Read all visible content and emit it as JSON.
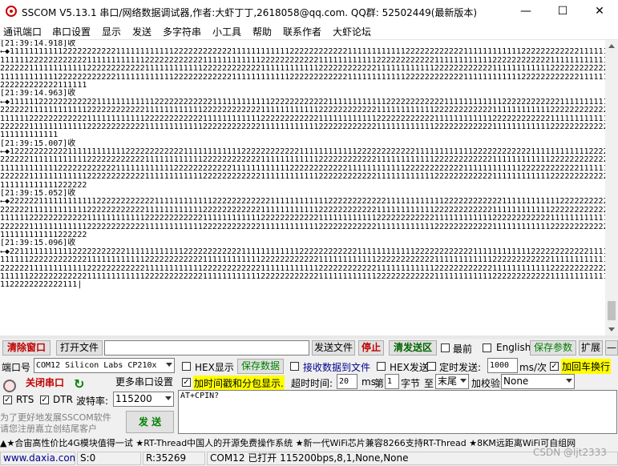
{
  "window": {
    "title": "SSCOM V5.13.1 串口/网络数据调试器,作者:大虾丁丁,2618058@qq.com. QQ群: 52502449(最新版本)",
    "minimize": "—",
    "maximize": "☐",
    "close": "✕"
  },
  "menu": [
    "通讯端口",
    "串口设置",
    "显示",
    "发送",
    "多字符串",
    "小工具",
    "帮助",
    "联系作者",
    "大虾论坛"
  ],
  "receive_lines": [
    "[21:39:14.918]收",
    "←◆1111111111122222222222111111111111222222222222111111111111222222222222111111111111222222222222111111111111222222222222111111",
    "111111222222222222111111111111222222222222111111111111222222222222111111111111222222222222111111111111222222222222111111111111",
    "222222111111111111222222222222111111111111222222222222111111111111222222222222111111111111222222222222111111111111222222222222",
    "111111111111222222222222111111111111222222222222111111111111222222222222111111111111222222222222111111111111222222222222111111",
    "222222222222111111",
    "[21:39:14.963]收",
    "←◆1111112222222222221111111111112222222222221111111111112222222222221111111111112222222222221111111111112222222222221111111111",
    "222222111111111111222222222222111111111111222222222222111111111111222222222222111111111111222222222222111111111111222222222222",
    "111111222222222222111111111111222222222222111111111111222222222222111111111111222222222222111111111111222222222222111111111111",
    "222222111111111111222222222222111111111111222222222222111111111111222222222222111111111111222222222222111111111111222222222222",
    "111111111111",
    "[21:39:15.007]收",
    "←◆1222222222221111111111112222222222221111111111112222222222221111111111112222222222221111111111112222222222221111111111112222",
    "222222111111111111222222222222111111111111222222222222111111111111222222222222111111111111222222222222111111111111222222222222",
    "111111111111222222222222111111111111222222222222111111111111222222222222111111111111222222222222111111111111222222222222111111",
    "222222111111111111222222222222111111111111222222222222111111111111222222222222111111111111222222222222111111111111222222222222",
    "111111111111222222",
    "[21:39:15.052]收",
    "←◆2222221111111111112222222222221111111111112222222222221111111111112222222222221111111111112222222222221111111111112222222222",
    "222222111111111111222222222222111111111111222222222222111111111111222222222222111111111111222222222222111111111111222222222222",
    "111111222222222222111111111111222222222222111111111111222222222222111111111111222222222222111111111111222222222222111111111111",
    "222222111111111111222222222222111111111111222222222222111111111111222222222222111111111111222222222222111111111111222222222222",
    "111111111111222222",
    "[21:39:15.096]收",
    "←◆2211111111111222222222221111111111112222222222221111111111112222222222221111111111112222222222221111111111112222222222221111",
    "111111222222222222111111111111222222222222111111111111222222222222111111111111222222222222111111111111222222222222111111111111",
    "222222111111111111222222222222111111111111222222222222111111111111222222222222111111111111222222222222111111111111222222222222",
    "111111222222222222111111111111222222222222111111111111222222222222111111111111222222222222111111111111222222222222111111111111",
    "1122222222222111|"
  ],
  "toolbar1": {
    "clear_window": "清除窗口",
    "open_file": "打开文件",
    "send_file": "发送文件",
    "stop": "停止",
    "clear_send": "清发送区",
    "top_most": "最前",
    "english": "English",
    "save_params": "保存参数",
    "expand": "扩展",
    "minus": "—"
  },
  "port_row": {
    "port_label": "端口号",
    "port_value": "COM12 Silicon Labs CP210x",
    "hex_display": "HEX显示",
    "save_data": "保存数据",
    "recv_to_file": "接收数据到文件",
    "hex_send": "HEX发送",
    "timed_send": "定时发送:",
    "interval": "1000",
    "interval_unit": "ms/次",
    "add_crlf": "加回车换行"
  },
  "row3": {
    "close_port": "关闭串口",
    "more_settings": "更多串口设置",
    "timestamp_split": "加时间戳和分包显示.",
    "timeout_label": "超时时间:",
    "timeout_value": "20",
    "ms": "ms",
    "nth_label": "第",
    "nth_value": "1",
    "byte_label": "字节",
    "to_label": "至",
    "end_value": "末尾",
    "checksum_label": "加校验",
    "checksum_value": "None"
  },
  "row4": {
    "rts": "RTS",
    "dtr": "DTR",
    "baud_label": "波特率:",
    "baud_value": "115200",
    "send_text": "AT+CPIN?"
  },
  "promo": {
    "line1": "为了更好地发展SSCOM软件",
    "line2": "请您注册嘉立创结尾客户",
    "send_button": "发  送"
  },
  "ticker": "▲★合宙高性价比4G模块值得一试 ★RT-Thread中国人的开源免费操作系统 ★新一代WiFi芯片兼容8266支持RT-Thread ★8KM远距离WiFi可自组网",
  "status": {
    "website": "www.daxia.com",
    "sent": "S:0",
    "received": "R:35269",
    "port_info": "COM12 已打开  115200bps,8,1,None,None",
    "watermark": "CSDN @ljt2333"
  }
}
